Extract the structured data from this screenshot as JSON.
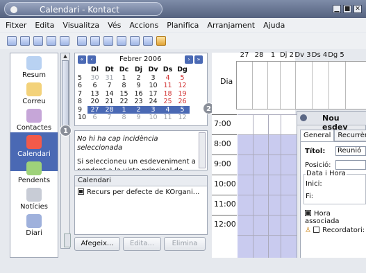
{
  "window": {
    "title": "Calendari - Kontact",
    "controls": [
      "▁",
      "■",
      "✕"
    ]
  },
  "menu": [
    "Fitxer",
    "Edita",
    "Visualitza",
    "Vés",
    "Accions",
    "Planifica",
    "Arranjament",
    "Ajuda"
  ],
  "sidebar": {
    "items": [
      {
        "label": "Resum",
        "icon": "summary-icon"
      },
      {
        "label": "Correu",
        "icon": "mail-icon"
      },
      {
        "label": "Contactes",
        "icon": "contacts-icon"
      },
      {
        "label": "Calendari",
        "icon": "calendar-icon",
        "active": true
      },
      {
        "label": "Pendents",
        "icon": "todo-icon"
      },
      {
        "label": "Notícies",
        "icon": "news-icon"
      },
      {
        "label": "Diari",
        "icon": "journal-icon"
      }
    ]
  },
  "mini_calendar": {
    "month": "Febrer 2006",
    "weekdays": [
      "Dl",
      "Dt",
      "Dc",
      "Dj",
      "Dv",
      "Ds",
      "Dg"
    ],
    "weeks": [
      {
        "wk": "5",
        "days": [
          "30",
          "31",
          "1",
          "2",
          "3",
          "4",
          "5"
        ]
      },
      {
        "wk": "6",
        "days": [
          "6",
          "7",
          "8",
          "9",
          "10",
          "11",
          "12"
        ]
      },
      {
        "wk": "7",
        "days": [
          "13",
          "14",
          "15",
          "16",
          "17",
          "18",
          "19"
        ]
      },
      {
        "wk": "8",
        "days": [
          "20",
          "21",
          "22",
          "23",
          "24",
          "25",
          "26"
        ]
      },
      {
        "wk": "9",
        "days": [
          "27",
          "28",
          "1",
          "2",
          "3",
          "4",
          "5"
        ]
      },
      {
        "wk": "10",
        "days": [
          "6",
          "7",
          "8",
          "9",
          "10",
          "11",
          "12"
        ]
      }
    ]
  },
  "callouts": [
    "1",
    "2",
    "3"
  ],
  "incidence": {
    "line1": "No hi ha cap incidència seleccionada",
    "line2": "Si seleccioneu un esdeveniment a pendent a la vista principal de"
  },
  "resources": {
    "header": "Calendari",
    "item": "Recurs per defecte de KOrgani..."
  },
  "buttons": {
    "add": "Afegeix...",
    "edit": "Edita...",
    "remove": "Elimina"
  },
  "day_headers": [
    "27",
    "28",
    "1",
    "Dj 2",
    "Dv 3",
    "Ds 4",
    "Dg 5"
  ],
  "dia_label": "Dia",
  "times": [
    "7:00",
    "8:00",
    "9:00",
    "10:00",
    "11:00",
    "12:00"
  ],
  "editor": {
    "title": "Nou esdev",
    "tabs": [
      "General",
      "Recurrèn"
    ],
    "titol_label": "Títol:",
    "titol_value": "Reunió",
    "posicio_label": "Posició:",
    "posicio_value": "",
    "datahora": "Data i Hora",
    "inici": "Inici:",
    "fi": "Fi:",
    "hora_associada": "Hora associada",
    "recordatori": "Recordatori:"
  }
}
